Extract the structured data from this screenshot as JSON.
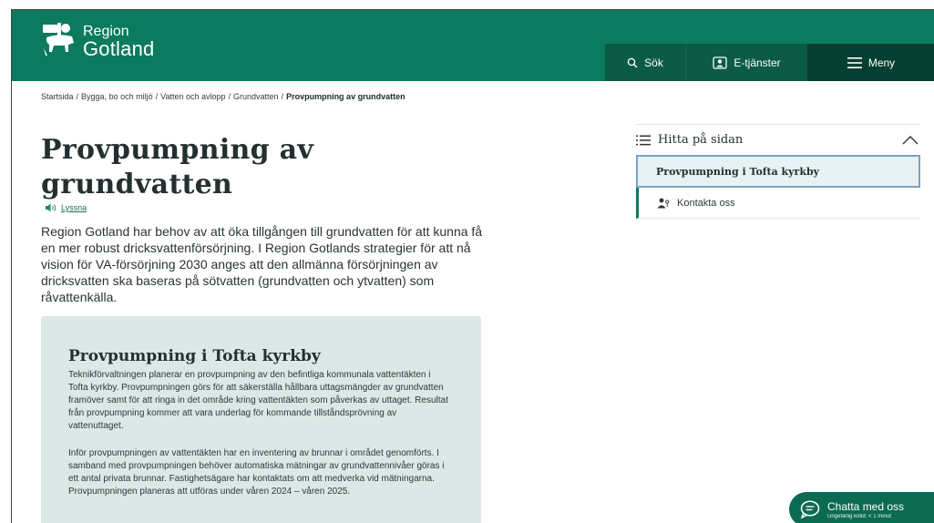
{
  "header": {
    "logo_region": "Region",
    "logo_gotland": "Gotland",
    "nav": {
      "search_label": "Sök",
      "eservices_label": "E-tjänster",
      "menu_label": "Meny"
    }
  },
  "breadcrumb": {
    "items": [
      "Startsida",
      "Bygga, bo och miljö",
      "Vatten och avlopp",
      "Grundvatten"
    ],
    "current": "Provpumpning av grundvatten"
  },
  "main": {
    "title": "Provpumpning av grundvatten",
    "listen_label": "Lyssna",
    "intro": "Region Gotland har behov av att öka tillgången till grundvatten för att kunna få en mer robust dricksvattenförsörjning. I Region Gotlands strategier för att nå vision för VA-försörjning 2030 anges att den allmänna försörjningen av dricksvatten ska baseras på sötvatten (grundvatten och ytvatten) som råvattenkälla.",
    "card": {
      "title": "Provpumpning i Tofta kyrkby",
      "paragraph1": "Teknikförvaltningen planerar en provpumpning av den befintliga kommunala vattentäkten i Tofta kyrkby. Provpumpningen görs för att säkerställa hållbara uttagsmängder av grundvatten framöver samt för att ringa in det område kring vattentäkten som påverkas av uttaget. Resultat från provpumpning kommer att vara underlag för kommande tillståndsprövning av vattenuttaget.",
      "paragraph2": "Inför provpumpningen av vattentäkten har en inventering av brunnar i området genomförts. I samband med provpumpningen behöver automatiska mätningar av grundvattennivåer göras i ett antal privata brunnar. Fastighetsägare har kontaktats om att medverka vid mätningarna. Provpumpningen planeras att utföras under våren 2024 – våren 2025."
    }
  },
  "toc": {
    "heading": "Hitta på sidan",
    "active_item": "Provpumpning i Tofta kyrkby",
    "contact_item": "Kontakta oss"
  },
  "chat": {
    "label": "Chatta med oss",
    "sub": "Ungefärlig kötid: < 1 minut"
  },
  "colors": {
    "brand_green": "#0b7a5f",
    "nav_dark": "#063f32",
    "card_bg": "#dbe8e5"
  }
}
